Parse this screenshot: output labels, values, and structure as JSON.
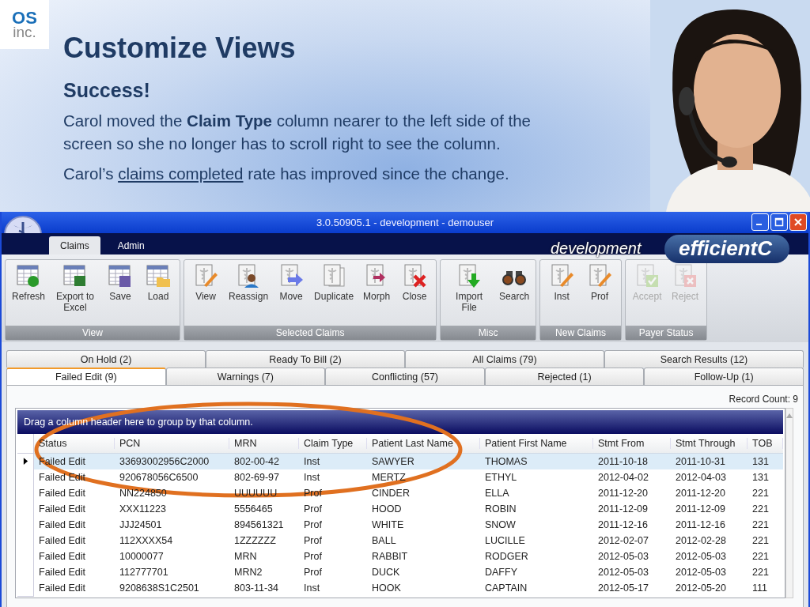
{
  "slide": {
    "logo": {
      "top": "OS",
      "bottom": "inc."
    },
    "title": "Customize Views",
    "subtitle": "Success!",
    "paragraphs": [
      [
        {
          "text": "Carol moved the **Claim Type** column nearer to the left side of the screen so she no longer has to scroll right to see the column.",
          "underline": false
        }
      ],
      [
        {
          "text": "Carol’s ",
          "underline": false
        },
        {
          "text": "claims completed",
          "underline": true
        },
        {
          "text": " rate has improved since the change.",
          "underline": false
        }
      ]
    ],
    "photo": {
      "kind": "picture"
    }
  },
  "window": {
    "title": "3.0.50905.1 - development - demouser"
  },
  "ribbon_tabs": [
    {
      "label": "Claims",
      "selected": true
    },
    {
      "label": "Admin",
      "selected": false
    }
  ],
  "brand": {
    "environment": "development",
    "name": "efficientC"
  },
  "groups": [
    {
      "label": "View",
      "buttons": [
        {
          "label": "Refresh",
          "kind": "refresh",
          "disabled": false
        },
        {
          "label": "Export to Excel",
          "kind": "excel",
          "disabled": false
        },
        {
          "label": "Save",
          "kind": "save",
          "disabled": false
        },
        {
          "label": "Load",
          "kind": "load",
          "disabled": false
        }
      ]
    },
    {
      "label": "Selected Claims",
      "buttons": [
        {
          "label": "View",
          "kind": "view",
          "disabled": false
        },
        {
          "label": "Reassign",
          "kind": "reassign",
          "disabled": false
        },
        {
          "label": "Move",
          "kind": "move",
          "disabled": false
        },
        {
          "label": "Duplicate",
          "kind": "duplicate",
          "disabled": false
        },
        {
          "label": "Morph",
          "kind": "morph",
          "disabled": false
        },
        {
          "label": "Close",
          "kind": "close",
          "disabled": false
        }
      ]
    },
    {
      "label": "Misc",
      "buttons": [
        {
          "label": "Import File",
          "kind": "import",
          "disabled": false
        },
        {
          "label": "Search",
          "kind": "search",
          "disabled": false
        }
      ]
    },
    {
      "label": "New Claims",
      "buttons": [
        {
          "label": "Inst",
          "kind": "view",
          "disabled": false
        },
        {
          "label": "Prof",
          "kind": "view",
          "disabled": false
        }
      ]
    },
    {
      "label": "Payer Status",
      "buttons": [
        {
          "label": "Accept",
          "kind": "accept",
          "disabled": true
        },
        {
          "label": "Reject",
          "kind": "reject",
          "disabled": true
        }
      ]
    }
  ],
  "tab_rows": [
    [
      {
        "label": "On Hold (2)",
        "selected": false
      },
      {
        "label": "Ready To Bill (2)",
        "selected": false
      },
      {
        "label": "All Claims (79)",
        "selected": false
      },
      {
        "label": "Search Results (12)",
        "selected": false
      }
    ],
    [
      {
        "label": "Failed Edit (9)",
        "selected": true
      },
      {
        "label": "Warnings (7)",
        "selected": false
      },
      {
        "label": "Conflicting (57)",
        "selected": false
      },
      {
        "label": "Rejected (1)",
        "selected": false
      },
      {
        "label": "Follow-Up (1)",
        "selected": false
      }
    ]
  ],
  "record_count": "Record Count: 9",
  "grid": {
    "group_hint": "Drag a column header here to group by that column.",
    "columns": [
      "Status",
      "PCN",
      "MRN",
      "Claim Type",
      "Patient Last Name",
      "Patient First Name",
      "Stmt From",
      "Stmt Through",
      "TOB"
    ],
    "rows": [
      {
        "selected": true,
        "cells": [
          "Failed Edit",
          "33693002956C2000",
          "802-00-42",
          "Inst",
          "SAWYER",
          "THOMAS",
          "2011-10-18",
          "2011-10-31",
          "131"
        ]
      },
      {
        "selected": false,
        "cells": [
          "Failed Edit",
          "920678056C6500",
          "802-69-97",
          "Inst",
          "MERTZ",
          "ETHYL",
          "2012-04-02",
          "2012-04-03",
          "131"
        ]
      },
      {
        "selected": false,
        "cells": [
          "Failed Edit",
          "NN224850",
          "UUUUUU",
          "Prof",
          "CINDER",
          "ELLA",
          "2011-12-20",
          "2011-12-20",
          "221"
        ]
      },
      {
        "selected": false,
        "cells": [
          "Failed Edit",
          "XXX11223",
          "5556465",
          "Prof",
          "HOOD",
          "ROBIN",
          "2011-12-09",
          "2011-12-09",
          "221"
        ]
      },
      {
        "selected": false,
        "cells": [
          "Failed Edit",
          "JJJ24501",
          "894561321",
          "Prof",
          "WHITE",
          "SNOW",
          "2011-12-16",
          "2011-12-16",
          "221"
        ]
      },
      {
        "selected": false,
        "cells": [
          "Failed Edit",
          "112XXXX54",
          "1ZZZZZZ",
          "Prof",
          "BALL",
          "LUCILLE",
          "2012-02-07",
          "2012-02-28",
          "221"
        ]
      },
      {
        "selected": false,
        "cells": [
          "Failed Edit",
          "10000077",
          "MRN",
          "Prof",
          "RABBIT",
          "RODGER",
          "2012-05-03",
          "2012-05-03",
          "221"
        ]
      },
      {
        "selected": false,
        "cells": [
          "Failed Edit",
          "112777701",
          "MRN2",
          "Prof",
          "DUCK",
          "DAFFY",
          "2012-05-03",
          "2012-05-03",
          "221"
        ]
      },
      {
        "selected": false,
        "cells": [
          "Failed Edit",
          "9208638S1C2501",
          "803-11-34",
          "Inst",
          "HOOK",
          "CAPTAIN",
          "2012-05-17",
          "2012-05-20",
          "111"
        ]
      }
    ]
  }
}
